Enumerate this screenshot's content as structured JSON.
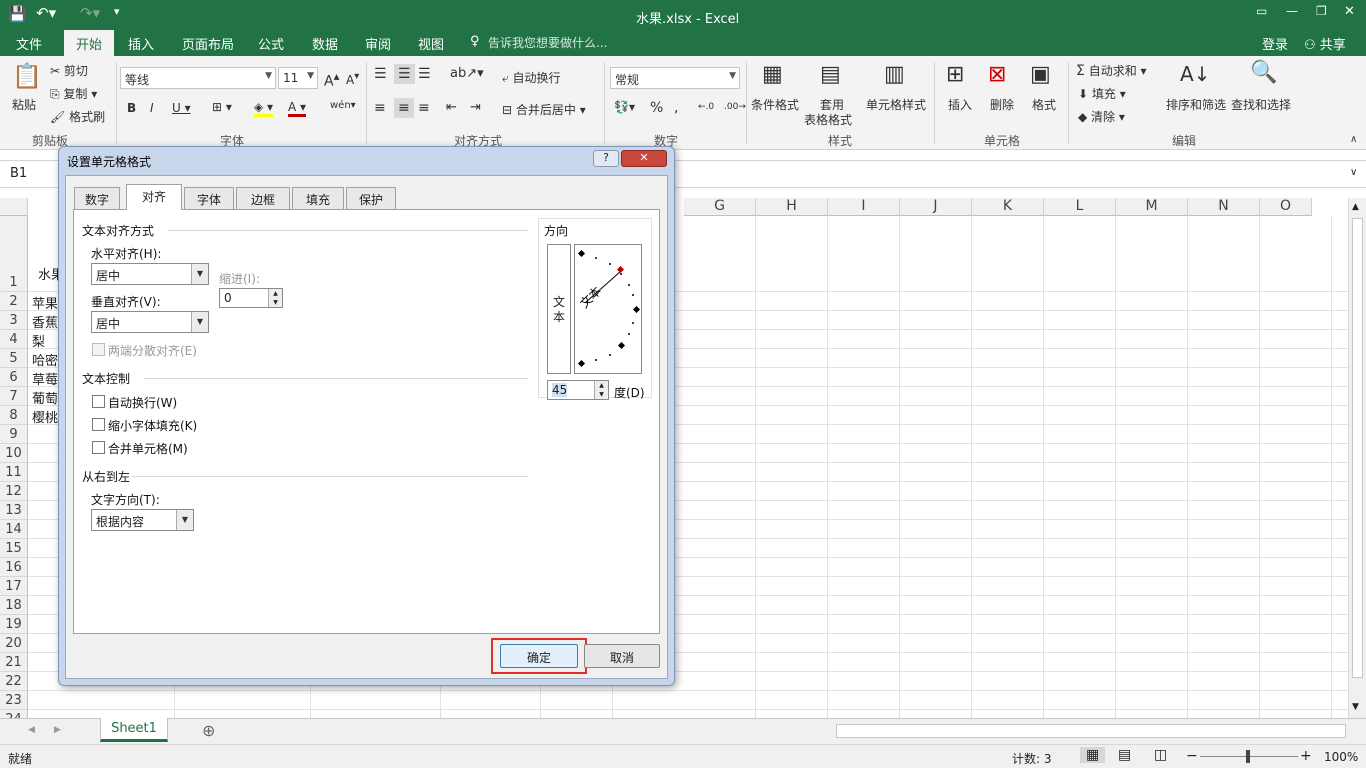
{
  "window": {
    "title": "水果.xlsx - Excel"
  },
  "menu": {
    "file": "文件",
    "home": "开始",
    "insert": "插入",
    "page_layout": "页面布局",
    "formulas": "公式",
    "data": "数据",
    "review": "审阅",
    "view": "视图",
    "tell_me": "告诉我您想要做什么...",
    "login": "登录",
    "share": "共享"
  },
  "ribbon": {
    "paste": "粘贴",
    "cut": "剪切",
    "copy": "复制",
    "format_painter": "格式刷",
    "clipboard": "剪贴板",
    "font_name": "等线",
    "font_size": "11",
    "font_group": "字体",
    "wrap_text": "自动换行",
    "merge_center": "合并后居中",
    "alignment_group": "对齐方式",
    "number_format": "常规",
    "number_group": "数字",
    "cond_format": "条件格式",
    "table_format_1": "套用",
    "table_format_2": "表格格式",
    "cell_styles": "单元格样式",
    "styles_group": "样式",
    "insert": "插入",
    "delete": "删除",
    "format": "格式",
    "cells_group": "单元格",
    "autosum": "自动求和",
    "fill": "填充",
    "clear": "清除",
    "sort_filter": "排序和筛选",
    "find_select": "查找和选择",
    "editing_group": "编辑"
  },
  "formula_bar": {
    "name_box": "B1"
  },
  "columns": [
    "G",
    "H",
    "I",
    "J",
    "K",
    "L",
    "M",
    "N",
    "O"
  ],
  "rows": [
    "1",
    "2",
    "3",
    "4",
    "5",
    "6",
    "7",
    "8",
    "9",
    "10",
    "11",
    "12",
    "13",
    "14",
    "15",
    "16",
    "17",
    "18",
    "19",
    "20",
    "21",
    "22",
    "23",
    "24"
  ],
  "cells": {
    "a1": "水果",
    "a2": "苹果",
    "a3": "香蕉",
    "a4": "梨",
    "a5": "哈密",
    "a6": "草莓",
    "a7": "葡萄",
    "a8": "樱桃"
  },
  "sheets": {
    "active": "Sheet1"
  },
  "status": {
    "ready": "就绪",
    "count": "计数: 3",
    "zoom": "100%"
  },
  "dialog": {
    "title": "设置单元格格式",
    "help": "?",
    "close": "✕",
    "tabs": [
      "数字",
      "对齐",
      "字体",
      "边框",
      "填充",
      "保护"
    ],
    "text_align_section": "文本对齐方式",
    "horizontal_label": "水平对齐(H):",
    "horizontal_value": "居中",
    "indent_label": "缩进(I):",
    "indent_value": "0",
    "vertical_label": "垂直对齐(V):",
    "vertical_value": "居中",
    "justify_distributed": "两端分散对齐(E)",
    "text_control_section": "文本控制",
    "wrap_text": "自动换行(W)",
    "shrink_to_fit": "缩小字体填充(K)",
    "merge_cells": "合并单元格(M)",
    "rtl_section": "从右到左",
    "text_direction_label": "文字方向(T):",
    "text_direction_value": "根据内容",
    "orientation_section": "方向",
    "vertical_text": "文本",
    "rotated_text": "文本",
    "degrees_value": "45",
    "degrees_label": "度(D)",
    "ok": "确定",
    "cancel": "取消"
  }
}
